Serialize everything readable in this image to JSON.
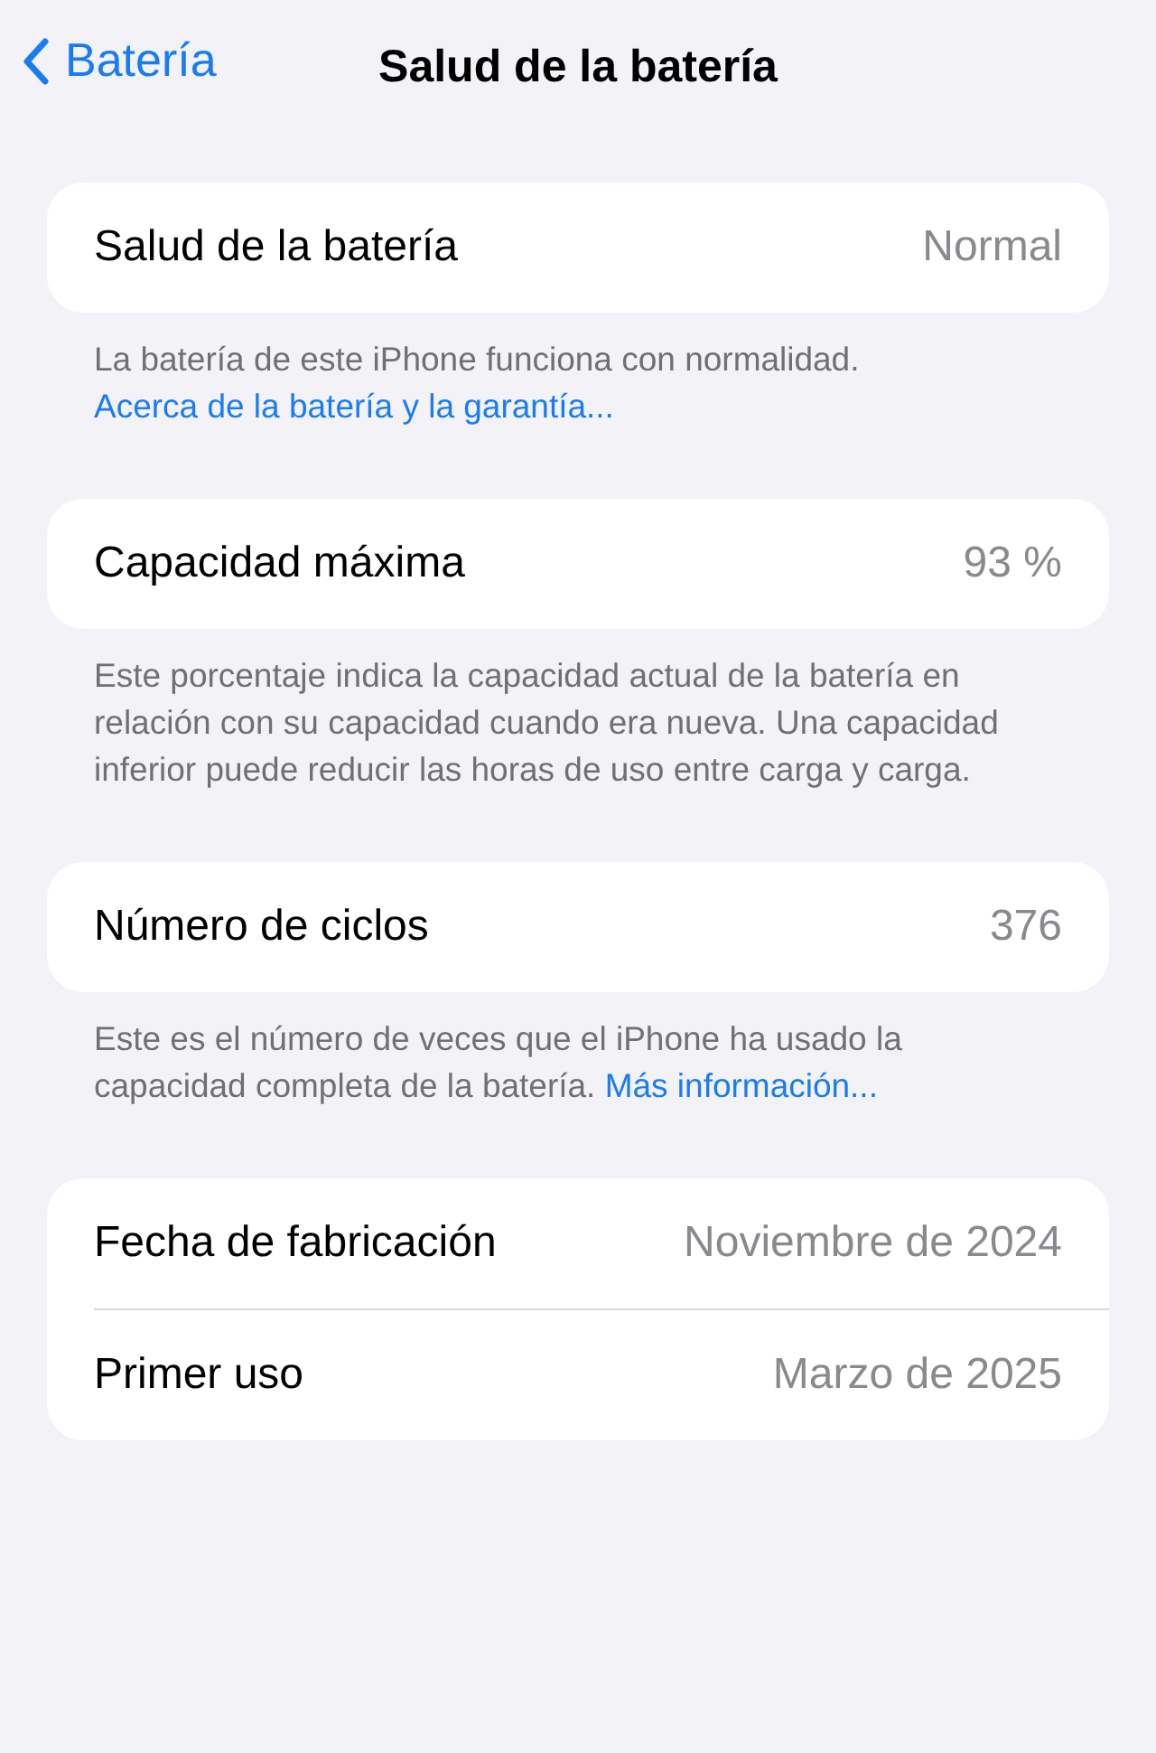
{
  "nav": {
    "back_label": "Batería",
    "title": "Salud de la batería"
  },
  "sections": [
    {
      "rows": [
        {
          "label": "Salud de la batería",
          "value": "Normal"
        }
      ],
      "footer": {
        "text": "La batería de este iPhone funciona con normalidad.",
        "link": "Acerca de la batería y la garantía..."
      }
    },
    {
      "rows": [
        {
          "label": "Capacidad máxima",
          "value": "93 %"
        }
      ],
      "footer": {
        "text": "Este porcentaje indica la capacidad actual de la batería en relación con su capacidad cuando era nueva. Una capacidad inferior puede reducir las horas de uso entre carga y carga."
      }
    },
    {
      "rows": [
        {
          "label": "Número de ciclos",
          "value": "376"
        }
      ],
      "footer": {
        "text": "Este es el número de veces que el iPhone ha usado la capacidad completa de la batería.",
        "link": "Más información..."
      }
    },
    {
      "rows": [
        {
          "label": "Fecha de fabricación",
          "value": "Noviembre de 2024"
        },
        {
          "label": "Primer uso",
          "value": "Marzo de 2025"
        }
      ]
    }
  ]
}
